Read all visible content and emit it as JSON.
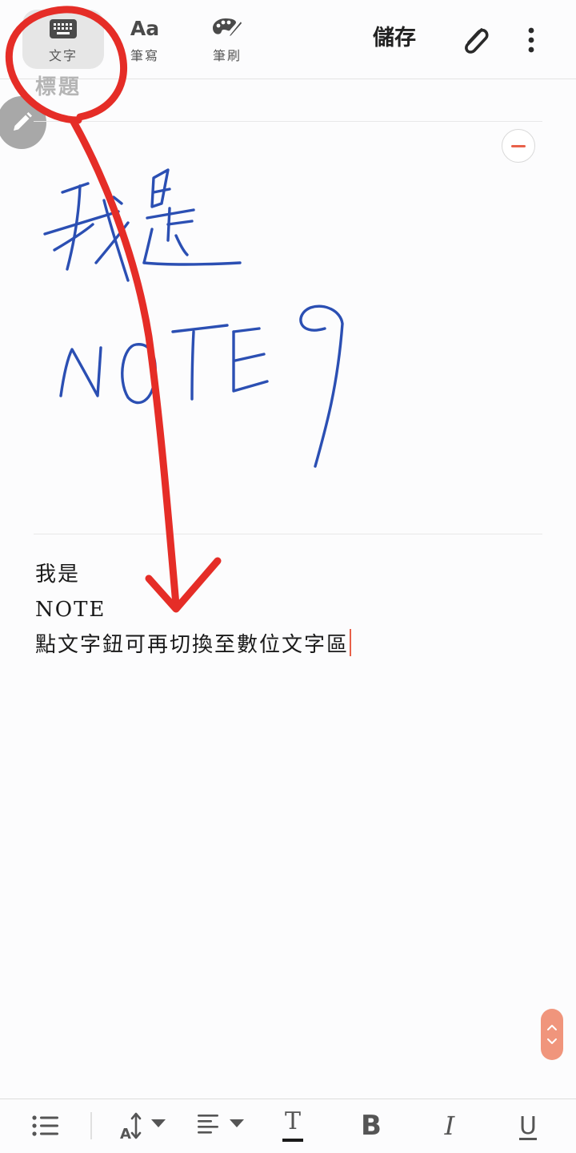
{
  "toolbar": {
    "text_mode_label": "文字",
    "handwriting_mode_label": "筆寫",
    "brush_mode_label": "筆刷",
    "handwriting_icon_text": "Aa",
    "save_label": "儲存",
    "active_mode": "text"
  },
  "note": {
    "title_placeholder": "標題",
    "body_lines": [
      "我是",
      "NOTE",
      "點文字鈕可再切換至數位文字區"
    ]
  },
  "format_bar": {
    "bold_glyph": "B",
    "italic_glyph": "I",
    "underline_glyph": "U",
    "text_color_glyph": "T"
  },
  "icons": [
    "keyboard-icon",
    "brush-palette-icon",
    "paperclip-icon",
    "more-vert-icon",
    "pencil-icon",
    "minus-icon",
    "list-icon",
    "font-size-icon",
    "align-icon",
    "scroll-up-icon",
    "scroll-down-icon"
  ],
  "colors": {
    "accent": "#e8614a",
    "ink_blue": "#2b4fb3",
    "annotation_red": "#e52d27",
    "scroll_pill": "#f0957c"
  }
}
